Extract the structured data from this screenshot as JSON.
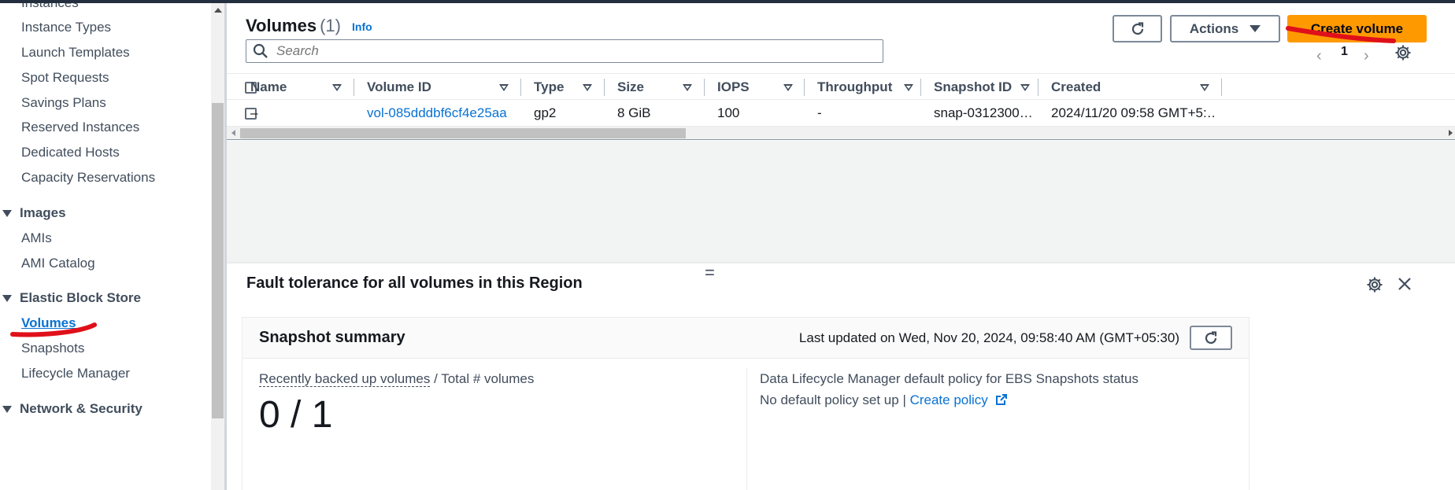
{
  "colors": {
    "accent": "#0972d3",
    "primary_button": "#ff9900",
    "annotation": "#e0101a"
  },
  "sidebar": {
    "items": [
      {
        "label": "Instances"
      },
      {
        "label": "Instance Types"
      },
      {
        "label": "Launch Templates"
      },
      {
        "label": "Spot Requests"
      },
      {
        "label": "Savings Plans"
      },
      {
        "label": "Reserved Instances"
      },
      {
        "label": "Dedicated Hosts"
      },
      {
        "label": "Capacity Reservations"
      }
    ],
    "sections": [
      {
        "label": "Images",
        "items": [
          "AMIs",
          "AMI Catalog"
        ]
      },
      {
        "label": "Elastic Block Store",
        "items": [
          "Volumes",
          "Snapshots",
          "Lifecycle Manager"
        ],
        "active": "Volumes"
      },
      {
        "label": "Network & Security"
      }
    ]
  },
  "header": {
    "title": "Volumes",
    "count": "(1)",
    "info": "Info",
    "refresh_icon": "refresh-icon",
    "actions_label": "Actions",
    "create_label": "Create volume"
  },
  "search": {
    "placeholder": "Search"
  },
  "pagination": {
    "current_page": "1"
  },
  "table": {
    "columns": [
      "Name",
      "Volume ID",
      "Type",
      "Size",
      "IOPS",
      "Throughput",
      "Snapshot ID",
      "Created"
    ],
    "rows": [
      {
        "name": "–",
        "volume_id": "vol-085dddbf6cf4e25aa",
        "type": "gp2",
        "size": "8 GiB",
        "iops": "100",
        "throughput": "-",
        "snapshot_id": "snap-0312300…",
        "created": "2024/11/20 09:58 GMT+5:…"
      }
    ]
  },
  "fault_panel": {
    "title": "Fault tolerance for all volumes in this Region",
    "summary_title": "Snapshot summary",
    "last_updated": "Last updated on Wed, Nov 20, 2024, 09:58:40 AM (GMT+05:30)",
    "recent_link": "Recently backed up volumes",
    "recent_suffix": " / Total # volumes",
    "recent_value": "0 / 1",
    "dlm_label": "Data Lifecycle Manager default policy for EBS Snapshots status",
    "dlm_value": "No default policy set up | ",
    "create_policy": "Create policy"
  }
}
